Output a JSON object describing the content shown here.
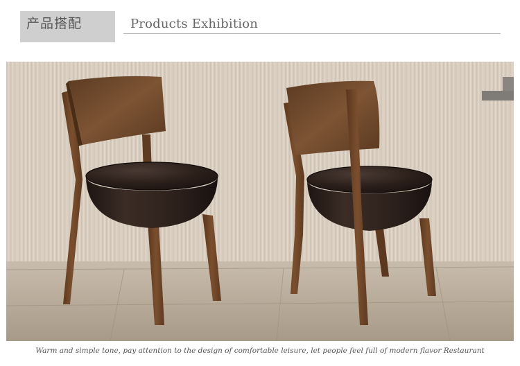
{
  "header": {
    "tag_label": "产品搭配",
    "section_title": "Products Exhibition"
  },
  "photo": {
    "subject": "two wooden dining chairs with round dark leather seats",
    "wall_color": "#d9cdbd",
    "floor_color": "#b9ad9d",
    "wood_color": "#6b4326",
    "leather_color": "#2a1d18"
  },
  "caption": "Warm and simple tone, pay attention to the design of comfortable leisure, let people feel full of modern flavor Restaurant"
}
